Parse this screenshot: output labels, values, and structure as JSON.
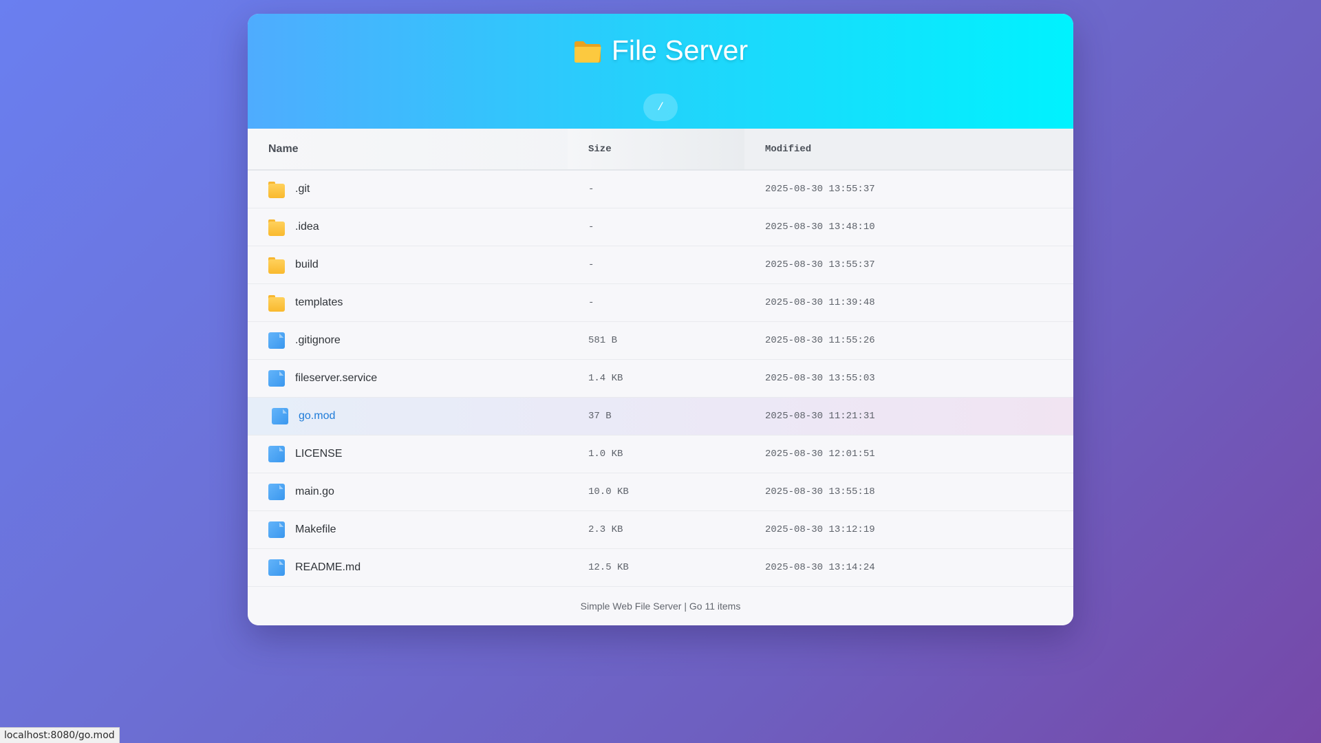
{
  "header": {
    "title": "File Server",
    "title_icon": "folder-icon",
    "breadcrumb": "/"
  },
  "table": {
    "columns": [
      "Name",
      "Size",
      "Modified"
    ],
    "rows": [
      {
        "name": ".git",
        "type": "folder",
        "size": "-",
        "modified": "2025-08-30 13:55:37"
      },
      {
        "name": ".idea",
        "type": "folder",
        "size": "-",
        "modified": "2025-08-30 13:48:10"
      },
      {
        "name": "build",
        "type": "folder",
        "size": "-",
        "modified": "2025-08-30 13:55:37"
      },
      {
        "name": "templates",
        "type": "folder",
        "size": "-",
        "modified": "2025-08-30 11:39:48"
      },
      {
        "name": ".gitignore",
        "type": "file",
        "size": "581 B",
        "modified": "2025-08-30 11:55:26"
      },
      {
        "name": "fileserver.service",
        "type": "file",
        "size": "1.4 KB",
        "modified": "2025-08-30 13:55:03"
      },
      {
        "name": "go.mod",
        "type": "file",
        "size": "37 B",
        "modified": "2025-08-30 11:21:31",
        "hovered": true
      },
      {
        "name": "LICENSE",
        "type": "file",
        "size": "1.0 KB",
        "modified": "2025-08-30 12:01:51"
      },
      {
        "name": "main.go",
        "type": "file",
        "size": "10.0 KB",
        "modified": "2025-08-30 13:55:18"
      },
      {
        "name": "Makefile",
        "type": "file",
        "size": "2.3 KB",
        "modified": "2025-08-30 13:12:19"
      },
      {
        "name": "README.md",
        "type": "file",
        "size": "12.5 KB",
        "modified": "2025-08-30 13:14:24"
      }
    ]
  },
  "footer": {
    "text": "Simple Web File Server | Go 11 items"
  },
  "status_bar": {
    "url": "localhost:8080/go.mod"
  },
  "colors": {
    "header_gradient_start": "#4facfe",
    "header_gradient_end": "#00f2fe",
    "folder": "#f9b92e",
    "file": "#3a97ee",
    "link_hover": "#1e7bd8"
  }
}
